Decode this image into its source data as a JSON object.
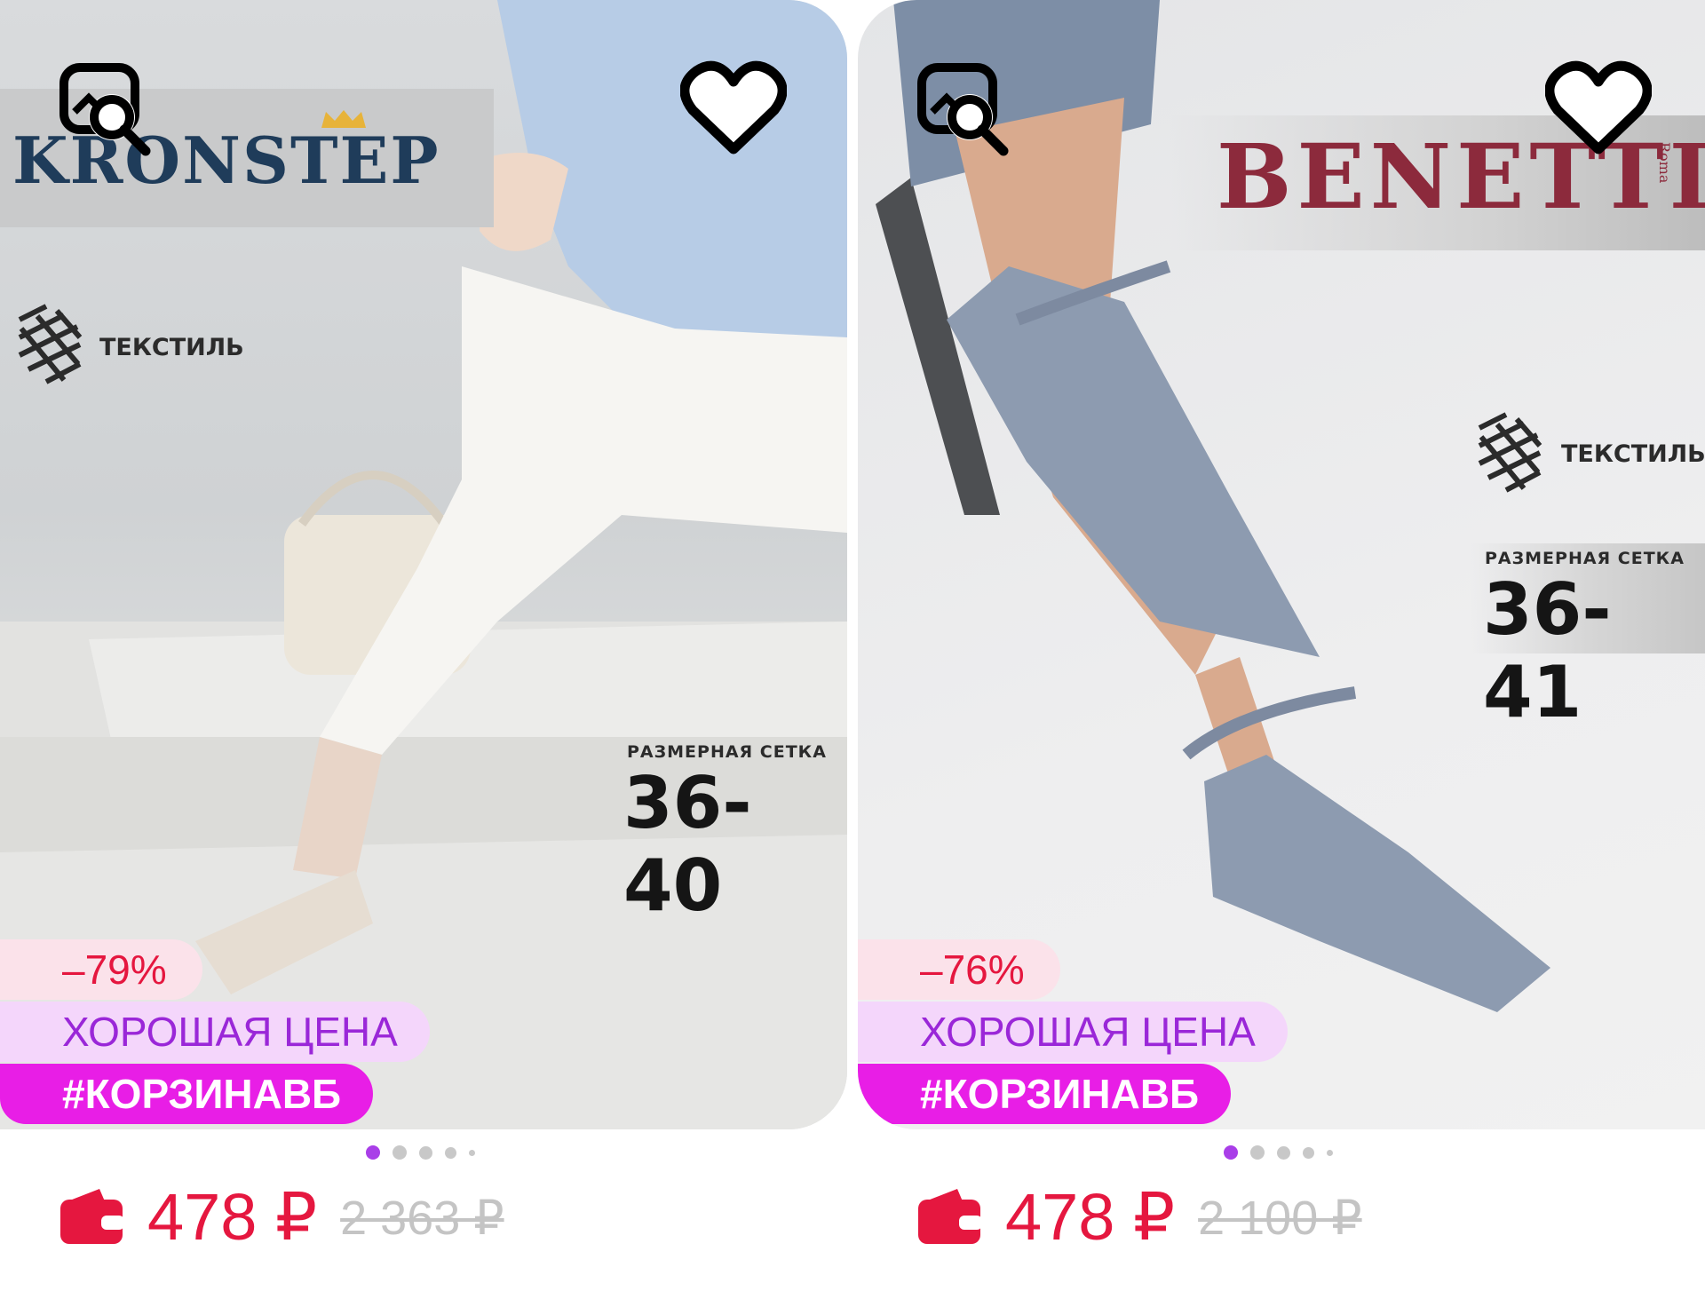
{
  "cards": [
    {
      "brand": "KRONSTEP",
      "material": "ТЕКСТИЛЬ",
      "size_title": "РАЗМЕРНАЯ СЕТКА",
      "size_range": "36-40",
      "discount": "–79%",
      "good_price": "ХОРОШАЯ ЦЕНА",
      "tag": "#КОРЗИНАВБ",
      "price": "478 ₽",
      "old_price": "2 363 ₽",
      "active_slide": 1
    },
    {
      "brand": "BENETTI",
      "brand_small": "Roma",
      "material": "ТЕКСТИЛЬ",
      "size_title": "РАЗМЕРНАЯ СЕТКА",
      "size_range": "36-41",
      "discount": "–76%",
      "good_price": "ХОРОШАЯ ЦЕНА",
      "tag": "#КОРЗИНАВБ",
      "price": "478 ₽",
      "old_price": "2 100 ₽",
      "active_slide": 1
    }
  ],
  "colors": {
    "accent_red": "#e5173f",
    "accent_purple": "#9a27d8",
    "tag_magenta": "#e81ee6",
    "dot_active": "#a93ee8"
  },
  "icons": [
    "image-search-icon",
    "heart-icon",
    "wallet-icon",
    "textile-icon"
  ]
}
